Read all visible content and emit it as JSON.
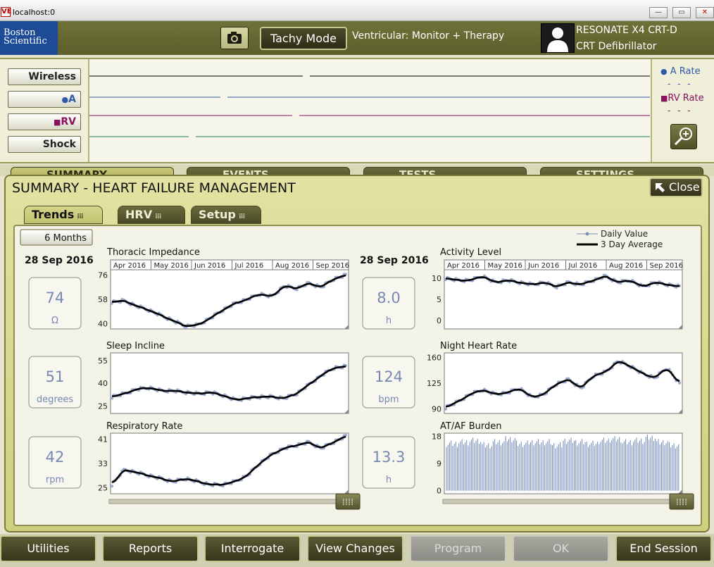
{
  "window": {
    "title": "localhost:0",
    "app_icon": "VE"
  },
  "header": {
    "logo_line1": "Boston",
    "logo_line2": "Scientific",
    "mode_button": "Tachy Mode",
    "ventricular_mode": "Ventricular: Monitor + Therapy",
    "device_model": "RESONATE X4 CRT-D",
    "device_type": "CRT Defibrillator",
    "camera_icon": "camera-icon",
    "patient_icon": "person-icon"
  },
  "egm": {
    "channels": [
      {
        "label": "Wireless",
        "color": "#000000"
      },
      {
        "label": "A",
        "color": "#2e5aa8",
        "marker": "●"
      },
      {
        "label": "RV",
        "color": "#8a1060",
        "marker": "■"
      },
      {
        "label": "Shock",
        "color": "#1a8050"
      }
    ],
    "legend": [
      {
        "label": "A Rate",
        "marker": "●",
        "color": "#2e5aa8"
      },
      {
        "label": "RV Rate",
        "marker": "■",
        "color": "#8a1060"
      }
    ],
    "zoom_icon": "zoom-in-icon"
  },
  "main_tabs": [
    "SUMMARY",
    "EVENTS",
    "TESTS",
    "SETTINGS"
  ],
  "panel": {
    "title": "SUMMARY - HEART FAILURE MANAGEMENT",
    "close_label": "Close",
    "subtabs": [
      "Trends",
      "HRV",
      "Setup"
    ],
    "period_button": "6 Months",
    "legend_daily": "Daily Value",
    "legend_avg": "3 Day Average",
    "left_date": "28 Sep 2016",
    "right_date": "28 Sep 2016",
    "months": [
      "Apr 2016",
      "May 2016",
      "Jun 2016",
      "Jul 2016",
      "Aug 2016",
      "Sep 2016"
    ]
  },
  "chart_data": [
    {
      "type": "line",
      "title": "Thoracic Impedance",
      "current_value": "74",
      "unit": "Ω",
      "yticks": [
        40,
        58,
        76
      ],
      "ylim": [
        36,
        80
      ],
      "series": [
        {
          "values": [
            56,
            57,
            53,
            50,
            46,
            42,
            38,
            39,
            44,
            50,
            55,
            58,
            62,
            60,
            68,
            66,
            70,
            67,
            73,
            76
          ]
        }
      ]
    },
    {
      "type": "line",
      "title": "Activity Level",
      "current_value": "8.0",
      "unit": "h",
      "yticks": [
        0,
        5,
        10
      ],
      "ylim": [
        -2,
        12
      ],
      "series": [
        {
          "values": [
            10,
            9.5,
            9.5,
            10.5,
            9,
            9.5,
            9,
            8.5,
            9,
            8,
            9,
            8.5,
            9.5,
            10.5,
            9,
            9.5,
            8,
            9,
            8.5,
            8
          ]
        }
      ]
    },
    {
      "type": "line",
      "title": "Sleep Incline",
      "current_value": "51",
      "unit": "degrees",
      "yticks": [
        25,
        40,
        55
      ],
      "ylim": [
        20,
        60
      ],
      "series": [
        {
          "values": [
            31,
            33,
            36,
            37,
            35,
            35,
            34,
            33,
            34,
            32,
            29,
            30,
            31,
            31,
            30,
            33,
            39,
            45,
            50,
            51
          ]
        }
      ]
    },
    {
      "type": "line",
      "title": "Night Heart Rate",
      "current_value": "124",
      "unit": "bpm",
      "yticks": [
        90,
        125,
        160
      ],
      "ylim": [
        84,
        166
      ],
      "series": [
        {
          "values": [
            92,
            100,
            110,
            116,
            110,
            112,
            118,
            106,
            110,
            124,
            130,
            118,
            135,
            140,
            155,
            148,
            138,
            132,
            146,
            124
          ]
        }
      ]
    },
    {
      "type": "line",
      "title": "Respiratory Rate",
      "current_value": "42",
      "unit": "rpm",
      "yticks": [
        25,
        33,
        41
      ],
      "ylim": [
        23,
        43
      ],
      "series": [
        {
          "values": [
            26,
            31,
            30,
            29,
            28,
            27,
            28,
            27,
            26,
            26,
            27,
            29,
            33,
            36,
            38,
            39,
            40,
            38,
            40,
            42
          ]
        }
      ]
    },
    {
      "type": "bar",
      "title": "AT/AF Burden",
      "current_value": "13.3",
      "unit": "h",
      "yticks": [
        0,
        9,
        18
      ],
      "ylim": [
        -1,
        19
      ],
      "values_pattern": [
        15.5,
        16,
        16.5,
        15,
        16,
        17,
        15.5,
        16,
        16,
        15,
        16.5,
        16,
        15.5,
        16.5,
        17,
        16,
        16.5,
        17.5,
        16,
        15
      ]
    }
  ],
  "footer_buttons": [
    {
      "label": "Utilities",
      "enabled": true
    },
    {
      "label": "Reports",
      "enabled": true
    },
    {
      "label": "Interrogate",
      "enabled": true
    },
    {
      "label": "View Changes",
      "enabled": true
    },
    {
      "label": "Program",
      "enabled": false
    },
    {
      "label": "OK",
      "enabled": false
    },
    {
      "label": "End Session",
      "enabled": true
    }
  ]
}
